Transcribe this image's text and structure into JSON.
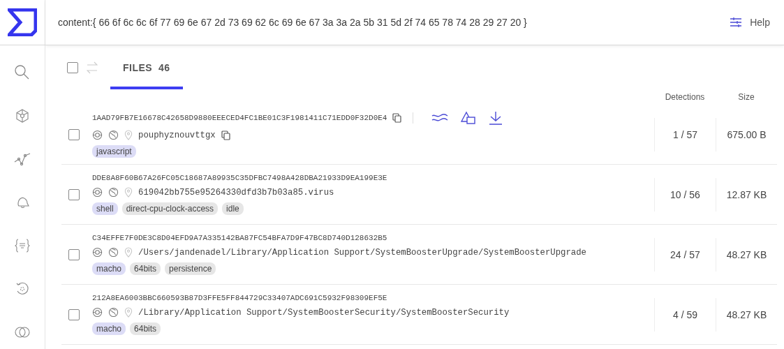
{
  "search": {
    "value": "content:{ 66 6f 6c 6c 6f 77 69 6e 67 2d 73 69 62 6c 69 6e 67 3a 3a 2a 5b 31 5d 2f 74 65 78 74 28 29 27 20 }"
  },
  "help": {
    "label": "Help"
  },
  "tabs": [
    {
      "label": "FILES",
      "count": "46",
      "selected": true
    }
  ],
  "select_all": {
    "checked": false
  },
  "columns": {
    "detections": "Detections",
    "size": "Size"
  },
  "rows": [
    {
      "hash": "1AAD79FB7E16678C42658D9880EEECED4FC1BE01C3F1981411C71EDD0F32D0E4",
      "name": "pouphyznouvttgx",
      "checked": false,
      "hovered": true,
      "tags": [
        {
          "label": "javascript",
          "kind": "type"
        }
      ],
      "detections": "1 / 57",
      "size": "675.00 B"
    },
    {
      "hash": "DDE8A8F60B67A26FC05C18687A89935C35DFBC7498A428DBA21933D9EA199E3E",
      "name": "619042bb755e95264330dfd3b7b03a85.virus",
      "checked": false,
      "hovered": false,
      "tags": [
        {
          "label": "shell",
          "kind": "type"
        },
        {
          "label": "direct-cpu-clock-access",
          "kind": "tag"
        },
        {
          "label": "idle",
          "kind": "tag"
        }
      ],
      "detections": "10 / 56",
      "size": "12.87 KB"
    },
    {
      "hash": "C34EFFE7F0DE3C8D04EFD9A7A335142BA87FC54BFA7D9F47BC8D740D128632B5",
      "name": "/Users/jandenadel/Library/Application Support/SystemBoosterUpgrade/SystemBoosterUpgrade",
      "checked": false,
      "hovered": false,
      "tags": [
        {
          "label": "macho",
          "kind": "type"
        },
        {
          "label": "64bits",
          "kind": "tag"
        },
        {
          "label": "persistence",
          "kind": "tag"
        }
      ],
      "detections": "24 / 57",
      "size": "48.27 KB"
    },
    {
      "hash": "212A8EA6003BBC660593B87D3FFE5FF844729C33407ADC691C5932F98309EF5E",
      "name": "/Library/Application Support/SystemBoosterSecurity/SystemBoosterSecurity",
      "checked": false,
      "hovered": false,
      "tags": [
        {
          "label": "macho",
          "kind": "type"
        },
        {
          "label": "64bits",
          "kind": "tag"
        }
      ],
      "detections": "4 / 59",
      "size": "48.27 KB"
    }
  ]
}
